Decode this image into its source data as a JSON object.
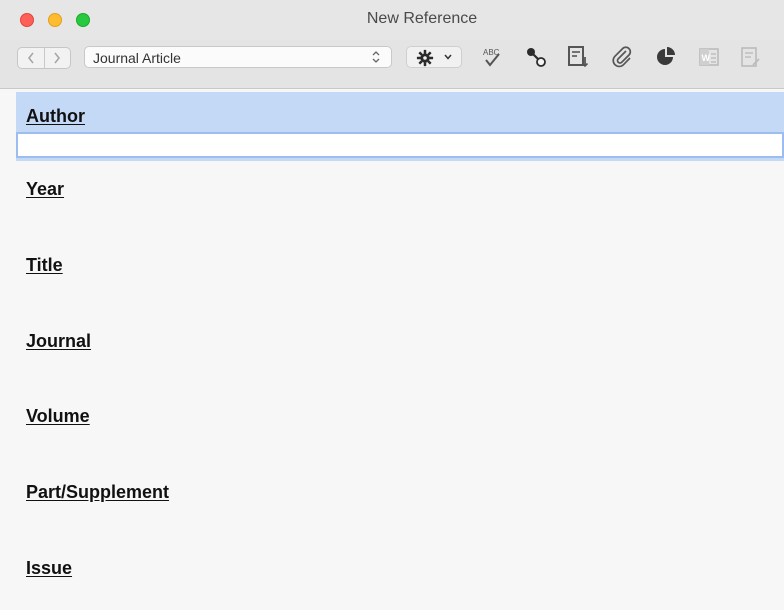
{
  "window": {
    "title": "New Reference"
  },
  "toolbar": {
    "reference_type": "Journal Article",
    "tools": [
      "back-icon",
      "forward-icon",
      "gear-icon",
      "spellcheck-icon",
      "link-icon",
      "find-fulltext-icon",
      "attach-icon",
      "pie-chart-icon",
      "word-icon",
      "edit-icon"
    ]
  },
  "fields": [
    {
      "label": "Author",
      "value": ""
    },
    {
      "label": "Year"
    },
    {
      "label": "Title"
    },
    {
      "label": "Journal"
    },
    {
      "label": "Volume"
    },
    {
      "label": "Part/Supplement"
    },
    {
      "label": "Issue"
    }
  ],
  "colors": {
    "active_field_bg": "#c4d9f6",
    "active_border": "#9dbdf0"
  }
}
